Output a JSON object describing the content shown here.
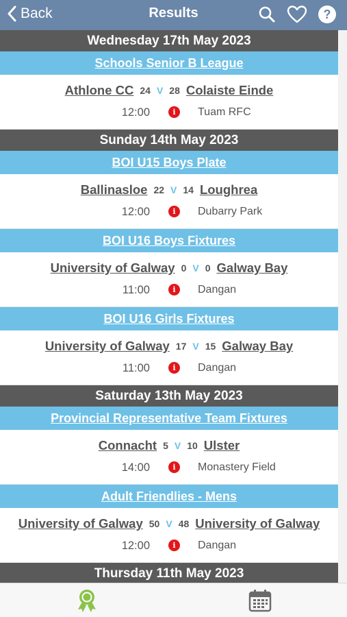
{
  "nav": {
    "back_label": "Back",
    "title": "Results",
    "icons": [
      "search-icon",
      "heart-icon",
      "help-icon"
    ]
  },
  "colors": {
    "navbar": "#6a86a8",
    "date_header": "#5a5a5a",
    "competition_header": "#6ec0e6",
    "info": "#e3161b",
    "active_tab": "#8bc34a",
    "inactive_tab": "#6b6b6b"
  },
  "sections": [
    {
      "date": "Wednesday 17th May 2023",
      "competitions": [
        {
          "name": "Schools Senior B League",
          "matches": [
            {
              "home": "Athlone CC",
              "home_score": "24",
              "vs": "V",
              "away_score": "28",
              "away": "Colaiste Einde",
              "time": "12:00",
              "info": "i",
              "venue": "Tuam RFC"
            }
          ]
        }
      ]
    },
    {
      "date": "Sunday 14th May 2023",
      "competitions": [
        {
          "name": "BOI U15 Boys Plate",
          "matches": [
            {
              "home": "Ballinasloe",
              "home_score": "22",
              "vs": "V",
              "away_score": "14",
              "away": "Loughrea",
              "time": "12:00",
              "info": "i",
              "venue": "Dubarry Park"
            }
          ]
        },
        {
          "name": "BOI U16 Boys Fixtures",
          "matches": [
            {
              "home": "University of Galway",
              "home_score": "0",
              "vs": "V",
              "away_score": "0",
              "away": "Galway Bay",
              "time": "11:00",
              "info": "i",
              "venue": "Dangan"
            }
          ]
        },
        {
          "name": "BOI U16 Girls Fixtures",
          "matches": [
            {
              "home": "University of Galway",
              "home_score": "17",
              "vs": "V",
              "away_score": "15",
              "away": "Galway Bay",
              "time": "11:00",
              "info": "i",
              "venue": "Dangan"
            }
          ]
        }
      ]
    },
    {
      "date": "Saturday 13th May 2023",
      "competitions": [
        {
          "name": "Provincial Representative Team Fixtures",
          "matches": [
            {
              "home": "Connacht",
              "home_score": "5",
              "vs": "V",
              "away_score": "10",
              "away": "Ulster",
              "time": "14:00",
              "info": "i",
              "venue": "Monastery Field"
            }
          ]
        },
        {
          "name": "Adult Friendlies - Mens",
          "matches": [
            {
              "home": "University of Galway",
              "home_score": "50",
              "vs": "V",
              "away_score": "48",
              "away": "University of Galway",
              "time": "12:00",
              "info": "i",
              "venue": "Dangan"
            }
          ]
        }
      ]
    },
    {
      "date": "Thursday 11th May 2023",
      "competitions": []
    }
  ],
  "tabs": [
    {
      "icon": "award-icon",
      "active": true
    },
    {
      "icon": "calendar-icon",
      "active": false
    }
  ]
}
